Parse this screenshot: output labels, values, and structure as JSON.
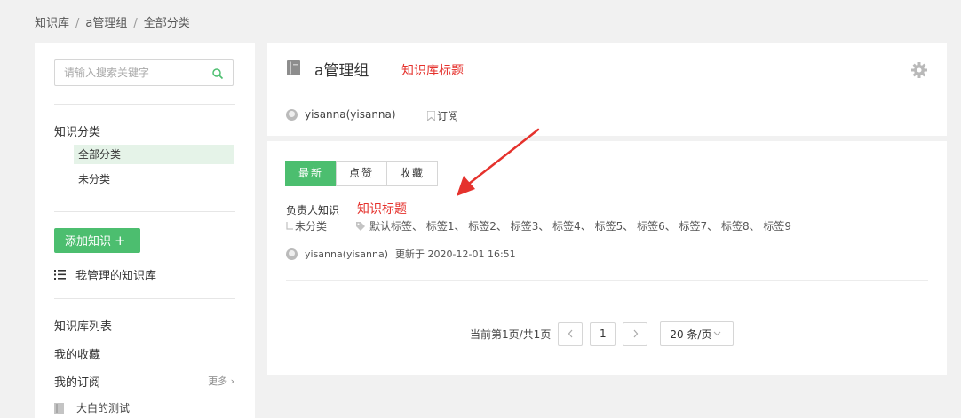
{
  "breadcrumb": [
    "知识库",
    "a管理组",
    "全部分类"
  ],
  "sidebar": {
    "search_placeholder": "请输入搜索关键字",
    "category_heading": "知识分类",
    "categories": [
      {
        "label": "全部分类",
        "active": true
      },
      {
        "label": "未分类",
        "active": false
      }
    ],
    "add_button": "添加知识",
    "add_plus": "+",
    "managed_link": "我管理的知识库",
    "links": [
      "知识库列表",
      "我的收藏",
      "我的订阅"
    ],
    "more_label": "更多 ›",
    "subscribed": [
      "大白的测试"
    ]
  },
  "header": {
    "kb_title": "a管理组",
    "annotation": "知识库标题",
    "owner": "yisanna(yisanna)",
    "subscribe_label": "订阅"
  },
  "tabs": [
    {
      "label": "最新",
      "active": true
    },
    {
      "label": "点赞",
      "active": false
    },
    {
      "label": "收藏",
      "active": false
    }
  ],
  "item": {
    "title": "负责人知识",
    "annotation": "知识标题",
    "category": "未分类",
    "tags": "默认标签、 标签1、 标签2、 标签3、 标签4、 标签5、 标签6、 标签7、 标签8、 标签9",
    "author": "yisanna(yisanna)",
    "updated": "更新于 2020-12-01 16:51"
  },
  "pagination": {
    "summary": "当前第1页/共1页",
    "current_page": "1",
    "page_size": "20 条/页"
  },
  "colors": {
    "accent": "#4cbe6f",
    "annotation": "#e5322d"
  }
}
